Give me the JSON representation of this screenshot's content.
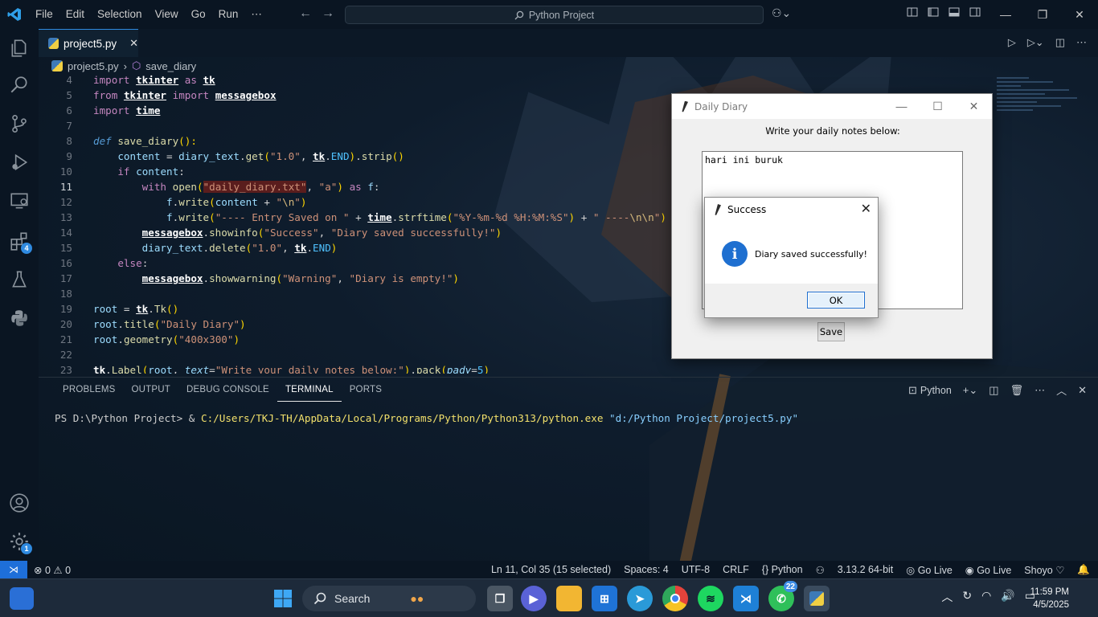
{
  "menu": [
    "File",
    "Edit",
    "Selection",
    "View",
    "Go",
    "Run",
    "⋯"
  ],
  "search_title": "Python Project",
  "tab": {
    "label": "project5.py",
    "close": "✕"
  },
  "breadcrumb": {
    "file": "project5.py",
    "symbol": "save_diary"
  },
  "activity_badges": {
    "extensions": "4",
    "settings": "1"
  },
  "editor": {
    "current_line": 11,
    "line_numbers": [
      "4",
      "5",
      "6",
      "7",
      "8",
      "9",
      "10",
      "11",
      "12",
      "13",
      "14",
      "15",
      "16",
      "17",
      "18",
      "19",
      "20",
      "21",
      "22",
      "23"
    ]
  },
  "panel": {
    "tabs": [
      "PROBLEMS",
      "OUTPUT",
      "DEBUG CONSOLE",
      "TERMINAL",
      "PORTS"
    ],
    "active_tab": "TERMINAL",
    "terminal_profile": "Python",
    "terminal_prompt": "PS D:\\Python Project> & ",
    "terminal_exe": "C:/Users/TKJ-TH/AppData/Local/Programs/Python/Python313/python.exe",
    "terminal_arg": " \"d:/Python Project/project5.py\""
  },
  "status": {
    "errors": "0",
    "warnings": "0",
    "position": "Ln 11, Col 35 (15 selected)",
    "spaces": "Spaces: 4",
    "encoding": "UTF-8",
    "eol": "CRLF",
    "language": "Python",
    "interpreter": "3.13.2 64-bit",
    "golive1": "Go Live",
    "golive2": "Go Live",
    "user": "Shoyo"
  },
  "taskbar": {
    "search": "Search",
    "whatsapp_badge": "22",
    "time": "11:59 PM",
    "date": "4/5/2025"
  },
  "diary_window": {
    "title": "Daily Diary",
    "label": "Write your daily notes below:",
    "text": "hari ini buruk",
    "save": "Save"
  },
  "dialog": {
    "title": "Success",
    "message": "Diary saved successfully!",
    "ok": "OK"
  }
}
